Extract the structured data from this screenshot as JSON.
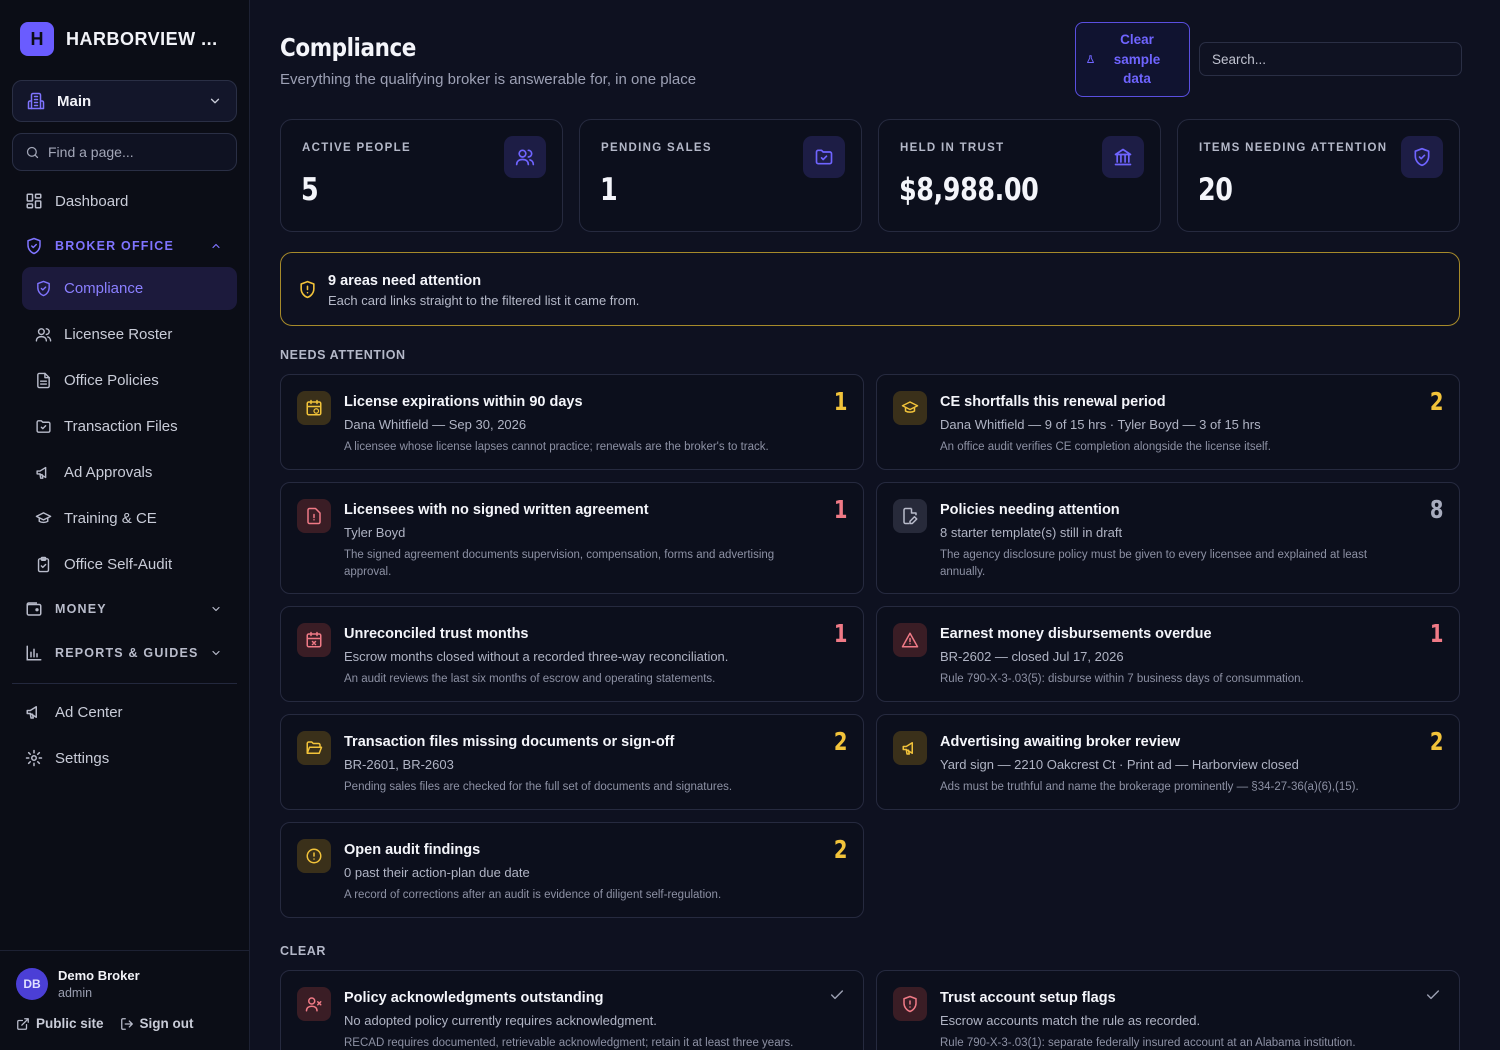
{
  "brand": {
    "logo_letter": "H",
    "name": "HARBORVIEW ..."
  },
  "sidebar": {
    "workspace": "Main",
    "find_placeholder": "Find a page...",
    "dashboard": "Dashboard",
    "sections": {
      "broker_office": "BROKER OFFICE",
      "money": "MONEY",
      "reports": "REPORTS & GUIDES"
    },
    "broker_items": [
      {
        "label": "Compliance",
        "icon": "shield-icon",
        "active": true
      },
      {
        "label": "Licensee Roster",
        "icon": "users-icon"
      },
      {
        "label": "Office Policies",
        "icon": "document-icon"
      },
      {
        "label": "Transaction Files",
        "icon": "folder-check-icon"
      },
      {
        "label": "Ad Approvals",
        "icon": "megaphone-icon"
      },
      {
        "label": "Training & CE",
        "icon": "graduation-cap-icon"
      },
      {
        "label": "Office Self-Audit",
        "icon": "clipboard-check-icon"
      }
    ],
    "ad_center": "Ad Center",
    "settings": "Settings",
    "user": {
      "initials": "DB",
      "name": "Demo Broker",
      "role": "admin"
    },
    "public_site": "Public site",
    "sign_out": "Sign out"
  },
  "header": {
    "title": "Compliance",
    "subtitle": "Everything the qualifying broker is answerable for, in one place",
    "clear_button": "Clear sample data",
    "search_placeholder": "Search..."
  },
  "stats": [
    {
      "label": "ACTIVE PEOPLE",
      "value": "5",
      "icon": "users-icon"
    },
    {
      "label": "PENDING SALES",
      "value": "1",
      "icon": "folder-check-icon"
    },
    {
      "label": "HELD IN TRUST",
      "value": "$8,988.00",
      "icon": "bank-icon"
    },
    {
      "label": "ITEMS NEEDING ATTENTION",
      "value": "20",
      "icon": "shield-check-icon"
    }
  ],
  "alert": {
    "title": "9 areas need attention",
    "subtitle": "Each card links straight to the filtered list it came from."
  },
  "needs_attention_label": "NEEDS ATTENTION",
  "clear_label": "CLEAR",
  "cards": [
    {
      "title": "License expirations within 90 days",
      "detail": "Dana Whitfield — Sep 30, 2026",
      "note": "A licensee whose license lapses cannot practice; renewals are the broker's to track.",
      "count": "1",
      "tone": "amber",
      "icon": "calendar-clock-icon"
    },
    {
      "title": "CE shortfalls this renewal period",
      "detail": "Dana Whitfield — 9 of 15 hrs · Tyler Boyd — 3 of 15 hrs",
      "note": "An office audit verifies CE completion alongside the license itself.",
      "count": "2",
      "tone": "amber",
      "icon": "graduation-cap-icon"
    },
    {
      "title": "Licensees with no signed written agreement",
      "detail": "Tyler Boyd",
      "note": "The signed agreement documents supervision, compensation, forms and advertising approval.",
      "count": "1",
      "tone": "red",
      "icon": "document-alert-icon"
    },
    {
      "title": "Policies needing attention",
      "detail": "8 starter template(s) still in draft",
      "note": "The agency disclosure policy must be given to every licensee and explained at least annually.",
      "count": "8",
      "tone": "gray",
      "icon": "document-edit-icon"
    },
    {
      "title": "Unreconciled trust months",
      "detail": "Escrow months closed without a recorded three-way reconciliation.",
      "note": "An audit reviews the last six months of escrow and operating statements.",
      "count": "1",
      "tone": "red",
      "icon": "calendar-x-icon"
    },
    {
      "title": "Earnest money disbursements overdue",
      "detail": "BR-2602 — closed Jul 17, 2026",
      "note": "Rule 790-X-3-.03(5): disburse within 7 business days of consummation.",
      "count": "1",
      "tone": "red",
      "icon": "warning-triangle-icon"
    },
    {
      "title": "Transaction files missing documents or sign-off",
      "detail": "BR-2601, BR-2603",
      "note": "Pending sales files are checked for the full set of documents and signatures.",
      "count": "2",
      "tone": "amber",
      "icon": "folder-open-icon"
    },
    {
      "title": "Advertising awaiting broker review",
      "detail": "Yard sign — 2210 Oakcrest Ct · Print ad — Harborview closed",
      "note": "Ads must be truthful and name the brokerage prominently — §34-27-36(a)(6),(15).",
      "count": "2",
      "tone": "amber",
      "icon": "megaphone-icon"
    },
    {
      "title": "Open audit findings",
      "detail": "0 past their action-plan due date",
      "note": "A record of corrections after an audit is evidence of diligent self-regulation.",
      "count": "2",
      "tone": "amber",
      "icon": "alert-circle-icon"
    }
  ],
  "clear_cards": [
    {
      "title": "Policy acknowledgments outstanding",
      "detail": "No adopted policy currently requires acknowledgment.",
      "note": "RECAD requires documented, retrievable acknowledgment; retain it at least three years.",
      "tone": "red",
      "icon": "user-x-icon"
    },
    {
      "title": "Trust account setup flags",
      "detail": "Escrow accounts match the rule as recorded.",
      "note": "Rule 790-X-3-.03(1): separate federally insured account at an Alabama institution.",
      "tone": "red",
      "icon": "shield-alert-icon"
    }
  ],
  "colors": {
    "accent": "#6a5cff",
    "amber": "#f2c33a",
    "red": "#f07a86",
    "alert_border": "#a68a2a"
  }
}
